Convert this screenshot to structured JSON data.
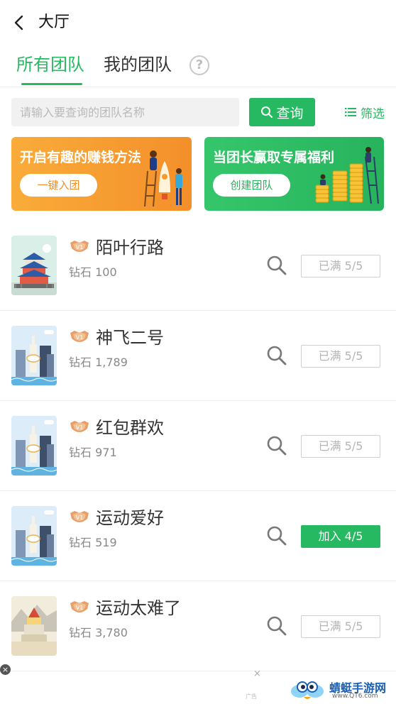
{
  "header": {
    "title": "大厅",
    "back_icon": "chevron-left-icon"
  },
  "tabs": [
    {
      "label": "所有团队",
      "active": true
    },
    {
      "label": "我的团队",
      "active": false
    }
  ],
  "help_icon_glyph": "?",
  "search": {
    "placeholder": "请输入要查询的团队名称",
    "value": "",
    "button_label": "查询",
    "filter_label": "筛选"
  },
  "banners": [
    {
      "title": "开启有趣的赚钱方法",
      "button": "一键入团"
    },
    {
      "title": "当团长赢取专属福利",
      "button": "创建团队"
    }
  ],
  "teams": [
    {
      "name": "陌叶行路",
      "diamond": "钻石 100",
      "status": "已满 5/5",
      "joinable": false,
      "thumb": "temple"
    },
    {
      "name": "神飞二号",
      "diamond": "钻石 1,789",
      "status": "已满 5/5",
      "joinable": false,
      "thumb": "city"
    },
    {
      "name": "红包群欢",
      "diamond": "钻石 971",
      "status": "已满 5/5",
      "joinable": false,
      "thumb": "city"
    },
    {
      "name": "运动爱好",
      "diamond": "钻石 519",
      "status": "加入 4/5",
      "joinable": true,
      "thumb": "city"
    },
    {
      "name": "运动太难了",
      "diamond": "钻石 3,780",
      "status": "已满 5/5",
      "joinable": false,
      "thumb": "tower"
    }
  ],
  "ad": {
    "close_glyph": "×",
    "dismiss_glyph": "×",
    "label": "广告"
  },
  "watermark": {
    "text": "蜻蜓手游网",
    "url": "www.QT6.com"
  },
  "colors": {
    "accent": "#27b961",
    "orange": "#f48f2a"
  }
}
